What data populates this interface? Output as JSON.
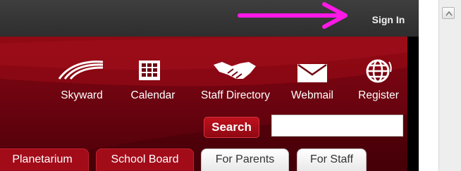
{
  "header": {
    "sign_in_label": "Sign In"
  },
  "quick_links": [
    {
      "label": "Skyward",
      "icon": "skyward-icon"
    },
    {
      "label": "Calendar",
      "icon": "calendar-icon"
    },
    {
      "label": "Staff Directory",
      "icon": "handshake-icon"
    },
    {
      "label": "Webmail",
      "icon": "envelope-icon"
    },
    {
      "label": "Register",
      "icon": "globe-icon"
    }
  ],
  "search": {
    "button_label": "Search",
    "value": ""
  },
  "tabs": [
    {
      "label": "Planetarium",
      "style": "red"
    },
    {
      "label": "School Board",
      "style": "red"
    },
    {
      "label": "For Parents",
      "style": "white"
    },
    {
      "label": "For Staff",
      "style": "white"
    }
  ],
  "annotation": {
    "arrow_color": "#ff19e6"
  },
  "colors": {
    "banner": "#850710",
    "topbar": "#353535",
    "tab_red": "#a20b18",
    "text": "#ffffff"
  }
}
